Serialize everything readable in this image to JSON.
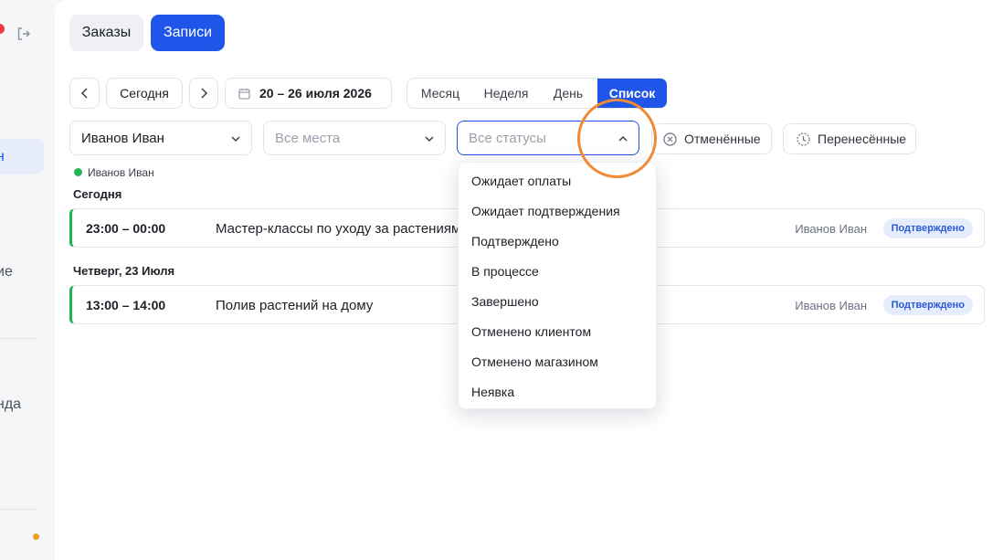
{
  "sidebar": {
    "items": [
      {
        "label": "ие"
      },
      {
        "label": "нда"
      }
    ]
  },
  "tabs": {
    "orders": "Заказы",
    "records": "Записи"
  },
  "toolbar": {
    "prev": "‹",
    "today": "Сегодня",
    "next": "›",
    "date_range": "20 – 26 июля 2026",
    "views": [
      "Месяц",
      "Неделя",
      "День",
      "Список"
    ],
    "active_view": "Список"
  },
  "filters": {
    "employee": "Иванов Иван",
    "places_placeholder": "Все места",
    "status_placeholder": "Все статусы",
    "cancelled": "Отменённые",
    "rescheduled": "Перенесённые"
  },
  "legend": {
    "employee": "Иванов Иван"
  },
  "groups": [
    {
      "day": "Сегодня",
      "items": [
        {
          "time": "23:00 – 00:00",
          "title": "Мастер-классы по уходу за растениями",
          "person": "Иванов Иван",
          "status": "Подтверждено"
        }
      ]
    },
    {
      "day": "Четверг, 23 Июля",
      "items": [
        {
          "time": "13:00 – 14:00",
          "title": "Полив растений на дому",
          "person": "Иванов Иван",
          "status": "Подтверждено"
        }
      ]
    }
  ],
  "status_options": [
    "Ожидает оплаты",
    "Ожидает подтверждения",
    "Подтверждено",
    "В процессе",
    "Завершено",
    "Отменено клиентом",
    "Отменено магазином",
    "Неявка"
  ],
  "colors": {
    "accent": "#1f55e8",
    "confirmed_bar": "#22b357",
    "highlight_ring": "#f08a36"
  }
}
